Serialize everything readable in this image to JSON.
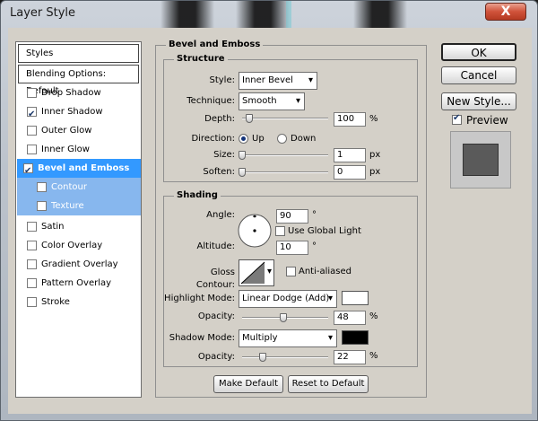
{
  "window": {
    "title": "Layer Style",
    "close_label": "X"
  },
  "style_list": [
    {
      "label": "Styles",
      "kind": "head"
    },
    {
      "label": "Blending Options: Default",
      "kind": "head"
    },
    {
      "label": "Drop Shadow",
      "checked": false
    },
    {
      "label": "Inner Shadow",
      "checked": true
    },
    {
      "label": "Outer Glow",
      "checked": false
    },
    {
      "label": "Inner Glow",
      "checked": false
    },
    {
      "label": "Bevel and Emboss",
      "checked": true,
      "selected": true
    },
    {
      "label": "Contour",
      "checked": false,
      "sub": true
    },
    {
      "label": "Texture",
      "checked": false,
      "sub": true
    },
    {
      "label": "Satin",
      "checked": false
    },
    {
      "label": "Color Overlay",
      "checked": false
    },
    {
      "label": "Gradient Overlay",
      "checked": false
    },
    {
      "label": "Pattern Overlay",
      "checked": false
    },
    {
      "label": "Stroke",
      "checked": false
    }
  ],
  "bevel": {
    "title": "Bevel and Emboss",
    "structure": {
      "title": "Structure",
      "style_label": "Style:",
      "style_value": "Inner Bevel",
      "technique_label": "Technique:",
      "technique_value": "Smooth",
      "depth_label": "Depth:",
      "depth_value": "100",
      "depth_unit": "%",
      "depth_fraction": 0.05,
      "direction_label": "Direction:",
      "dir_up": "Up",
      "dir_down": "Down",
      "direction_selected": "Up",
      "size_label": "Size:",
      "size_value": "1",
      "size_unit": "px",
      "size_fraction": 0.0,
      "soften_label": "Soften:",
      "soften_value": "0",
      "soften_unit": "px",
      "soften_fraction": 0.0
    },
    "shading": {
      "title": "Shading",
      "angle_label": "Angle:",
      "angle_value": "90",
      "angle_unit": "°",
      "global_light_label": "Use Global Light",
      "global_light_checked": false,
      "altitude_label": "Altitude:",
      "altitude_value": "10",
      "altitude_unit": "°",
      "gloss_label": "Gloss Contour:",
      "antialiased_label": "Anti-aliased",
      "antialiased_checked": false,
      "highlight_label": "Highlight Mode:",
      "highlight_value": "Linear Dodge (Add)",
      "highlight_color": "#ffffff",
      "hl_opacity_label": "Opacity:",
      "hl_opacity_value": "48",
      "hl_opacity_unit": "%",
      "hl_opacity_fraction": 0.48,
      "shadow_label": "Shadow Mode:",
      "shadow_value": "Multiply",
      "shadow_color": "#000000",
      "sh_opacity_label": "Opacity:",
      "sh_opacity_value": "22",
      "sh_opacity_unit": "%",
      "sh_opacity_fraction": 0.22
    },
    "make_default": "Make Default",
    "reset_default": "Reset to Default"
  },
  "side": {
    "ok": "OK",
    "cancel": "Cancel",
    "new_style": "New Style...",
    "preview_label": "Preview",
    "preview_checked": true
  }
}
